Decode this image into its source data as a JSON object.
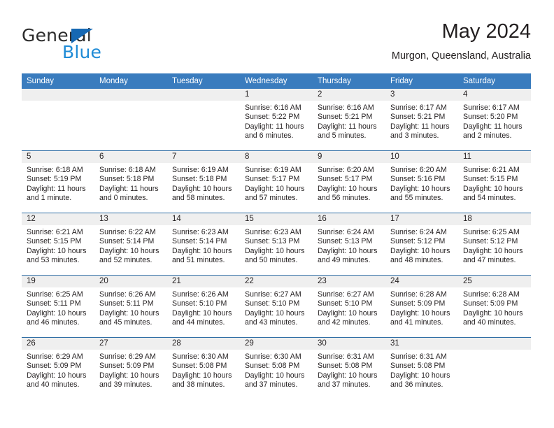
{
  "brand": {
    "name_part1": "General",
    "name_part2": "Blue",
    "accent_color": "#1668b3",
    "blue_text_color": "#1f8bd6"
  },
  "header": {
    "title": "May 2024",
    "location": "Murgon, Queensland, Australia"
  },
  "theme": {
    "header_bar_color": "#3a7cbe",
    "row_divider_color": "#2e6da4",
    "day_strip_color": "#efefef"
  },
  "weekday_headers": [
    "Sunday",
    "Monday",
    "Tuesday",
    "Wednesday",
    "Thursday",
    "Friday",
    "Saturday"
  ],
  "weeks": [
    [
      {
        "day": "",
        "empty": true,
        "sunrise": "",
        "sunset": "",
        "daylight1": "",
        "daylight2": ""
      },
      {
        "day": "",
        "empty": true,
        "sunrise": "",
        "sunset": "",
        "daylight1": "",
        "daylight2": ""
      },
      {
        "day": "",
        "empty": true,
        "sunrise": "",
        "sunset": "",
        "daylight1": "",
        "daylight2": ""
      },
      {
        "day": "1",
        "empty": false,
        "sunrise": "Sunrise: 6:16 AM",
        "sunset": "Sunset: 5:22 PM",
        "daylight1": "Daylight: 11 hours",
        "daylight2": "and 6 minutes."
      },
      {
        "day": "2",
        "empty": false,
        "sunrise": "Sunrise: 6:16 AM",
        "sunset": "Sunset: 5:21 PM",
        "daylight1": "Daylight: 11 hours",
        "daylight2": "and 5 minutes."
      },
      {
        "day": "3",
        "empty": false,
        "sunrise": "Sunrise: 6:17 AM",
        "sunset": "Sunset: 5:21 PM",
        "daylight1": "Daylight: 11 hours",
        "daylight2": "and 3 minutes."
      },
      {
        "day": "4",
        "empty": false,
        "sunrise": "Sunrise: 6:17 AM",
        "sunset": "Sunset: 5:20 PM",
        "daylight1": "Daylight: 11 hours",
        "daylight2": "and 2 minutes."
      }
    ],
    [
      {
        "day": "5",
        "empty": false,
        "sunrise": "Sunrise: 6:18 AM",
        "sunset": "Sunset: 5:19 PM",
        "daylight1": "Daylight: 11 hours",
        "daylight2": "and 1 minute."
      },
      {
        "day": "6",
        "empty": false,
        "sunrise": "Sunrise: 6:18 AM",
        "sunset": "Sunset: 5:18 PM",
        "daylight1": "Daylight: 11 hours",
        "daylight2": "and 0 minutes."
      },
      {
        "day": "7",
        "empty": false,
        "sunrise": "Sunrise: 6:19 AM",
        "sunset": "Sunset: 5:18 PM",
        "daylight1": "Daylight: 10 hours",
        "daylight2": "and 58 minutes."
      },
      {
        "day": "8",
        "empty": false,
        "sunrise": "Sunrise: 6:19 AM",
        "sunset": "Sunset: 5:17 PM",
        "daylight1": "Daylight: 10 hours",
        "daylight2": "and 57 minutes."
      },
      {
        "day": "9",
        "empty": false,
        "sunrise": "Sunrise: 6:20 AM",
        "sunset": "Sunset: 5:17 PM",
        "daylight1": "Daylight: 10 hours",
        "daylight2": "and 56 minutes."
      },
      {
        "day": "10",
        "empty": false,
        "sunrise": "Sunrise: 6:20 AM",
        "sunset": "Sunset: 5:16 PM",
        "daylight1": "Daylight: 10 hours",
        "daylight2": "and 55 minutes."
      },
      {
        "day": "11",
        "empty": false,
        "sunrise": "Sunrise: 6:21 AM",
        "sunset": "Sunset: 5:15 PM",
        "daylight1": "Daylight: 10 hours",
        "daylight2": "and 54 minutes."
      }
    ],
    [
      {
        "day": "12",
        "empty": false,
        "sunrise": "Sunrise: 6:21 AM",
        "sunset": "Sunset: 5:15 PM",
        "daylight1": "Daylight: 10 hours",
        "daylight2": "and 53 minutes."
      },
      {
        "day": "13",
        "empty": false,
        "sunrise": "Sunrise: 6:22 AM",
        "sunset": "Sunset: 5:14 PM",
        "daylight1": "Daylight: 10 hours",
        "daylight2": "and 52 minutes."
      },
      {
        "day": "14",
        "empty": false,
        "sunrise": "Sunrise: 6:23 AM",
        "sunset": "Sunset: 5:14 PM",
        "daylight1": "Daylight: 10 hours",
        "daylight2": "and 51 minutes."
      },
      {
        "day": "15",
        "empty": false,
        "sunrise": "Sunrise: 6:23 AM",
        "sunset": "Sunset: 5:13 PM",
        "daylight1": "Daylight: 10 hours",
        "daylight2": "and 50 minutes."
      },
      {
        "day": "16",
        "empty": false,
        "sunrise": "Sunrise: 6:24 AM",
        "sunset": "Sunset: 5:13 PM",
        "daylight1": "Daylight: 10 hours",
        "daylight2": "and 49 minutes."
      },
      {
        "day": "17",
        "empty": false,
        "sunrise": "Sunrise: 6:24 AM",
        "sunset": "Sunset: 5:12 PM",
        "daylight1": "Daylight: 10 hours",
        "daylight2": "and 48 minutes."
      },
      {
        "day": "18",
        "empty": false,
        "sunrise": "Sunrise: 6:25 AM",
        "sunset": "Sunset: 5:12 PM",
        "daylight1": "Daylight: 10 hours",
        "daylight2": "and 47 minutes."
      }
    ],
    [
      {
        "day": "19",
        "empty": false,
        "sunrise": "Sunrise: 6:25 AM",
        "sunset": "Sunset: 5:11 PM",
        "daylight1": "Daylight: 10 hours",
        "daylight2": "and 46 minutes."
      },
      {
        "day": "20",
        "empty": false,
        "sunrise": "Sunrise: 6:26 AM",
        "sunset": "Sunset: 5:11 PM",
        "daylight1": "Daylight: 10 hours",
        "daylight2": "and 45 minutes."
      },
      {
        "day": "21",
        "empty": false,
        "sunrise": "Sunrise: 6:26 AM",
        "sunset": "Sunset: 5:10 PM",
        "daylight1": "Daylight: 10 hours",
        "daylight2": "and 44 minutes."
      },
      {
        "day": "22",
        "empty": false,
        "sunrise": "Sunrise: 6:27 AM",
        "sunset": "Sunset: 5:10 PM",
        "daylight1": "Daylight: 10 hours",
        "daylight2": "and 43 minutes."
      },
      {
        "day": "23",
        "empty": false,
        "sunrise": "Sunrise: 6:27 AM",
        "sunset": "Sunset: 5:10 PM",
        "daylight1": "Daylight: 10 hours",
        "daylight2": "and 42 minutes."
      },
      {
        "day": "24",
        "empty": false,
        "sunrise": "Sunrise: 6:28 AM",
        "sunset": "Sunset: 5:09 PM",
        "daylight1": "Daylight: 10 hours",
        "daylight2": "and 41 minutes."
      },
      {
        "day": "25",
        "empty": false,
        "sunrise": "Sunrise: 6:28 AM",
        "sunset": "Sunset: 5:09 PM",
        "daylight1": "Daylight: 10 hours",
        "daylight2": "and 40 minutes."
      }
    ],
    [
      {
        "day": "26",
        "empty": false,
        "sunrise": "Sunrise: 6:29 AM",
        "sunset": "Sunset: 5:09 PM",
        "daylight1": "Daylight: 10 hours",
        "daylight2": "and 40 minutes."
      },
      {
        "day": "27",
        "empty": false,
        "sunrise": "Sunrise: 6:29 AM",
        "sunset": "Sunset: 5:09 PM",
        "daylight1": "Daylight: 10 hours",
        "daylight2": "and 39 minutes."
      },
      {
        "day": "28",
        "empty": false,
        "sunrise": "Sunrise: 6:30 AM",
        "sunset": "Sunset: 5:08 PM",
        "daylight1": "Daylight: 10 hours",
        "daylight2": "and 38 minutes."
      },
      {
        "day": "29",
        "empty": false,
        "sunrise": "Sunrise: 6:30 AM",
        "sunset": "Sunset: 5:08 PM",
        "daylight1": "Daylight: 10 hours",
        "daylight2": "and 37 minutes."
      },
      {
        "day": "30",
        "empty": false,
        "sunrise": "Sunrise: 6:31 AM",
        "sunset": "Sunset: 5:08 PM",
        "daylight1": "Daylight: 10 hours",
        "daylight2": "and 37 minutes."
      },
      {
        "day": "31",
        "empty": false,
        "sunrise": "Sunrise: 6:31 AM",
        "sunset": "Sunset: 5:08 PM",
        "daylight1": "Daylight: 10 hours",
        "daylight2": "and 36 minutes."
      },
      {
        "day": "",
        "empty": true,
        "sunrise": "",
        "sunset": "",
        "daylight1": "",
        "daylight2": ""
      }
    ]
  ]
}
